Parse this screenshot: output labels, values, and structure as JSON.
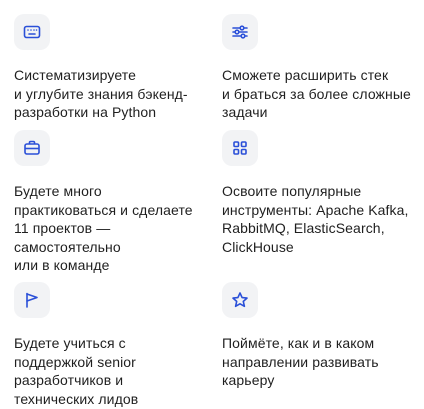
{
  "accent_color": "#2b50d8",
  "icon_bg_color": "#f2f3f5",
  "features": [
    {
      "icon": "keyboard-icon",
      "lines": [
        "Систематизируете",
        "и углубите знания бэкенд-",
        "разработки на Python"
      ]
    },
    {
      "icon": "sliders-icon",
      "lines": [
        "Сможете расширить стек",
        "и браться за более сложные",
        "задачи"
      ]
    },
    {
      "icon": "briefcase-icon",
      "lines": [
        "Будете много",
        "практиковаться и сделаете",
        "11 проектов —",
        "самостоятельно",
        "или в команде"
      ]
    },
    {
      "icon": "grid-icon",
      "lines": [
        "Освоите популярные",
        "инструменты: Apache Kafka,",
        "RabbitMQ, ElasticSearch,",
        "ClickHouse"
      ]
    },
    {
      "icon": "flag-icon",
      "lines": [
        "Будете учиться с",
        "поддержкой senior",
        "разработчиков и",
        "технических лидов"
      ]
    },
    {
      "icon": "star-icon",
      "lines": [
        "Поймёте, как и в каком",
        "направлении развивать",
        "карьеру"
      ]
    }
  ]
}
